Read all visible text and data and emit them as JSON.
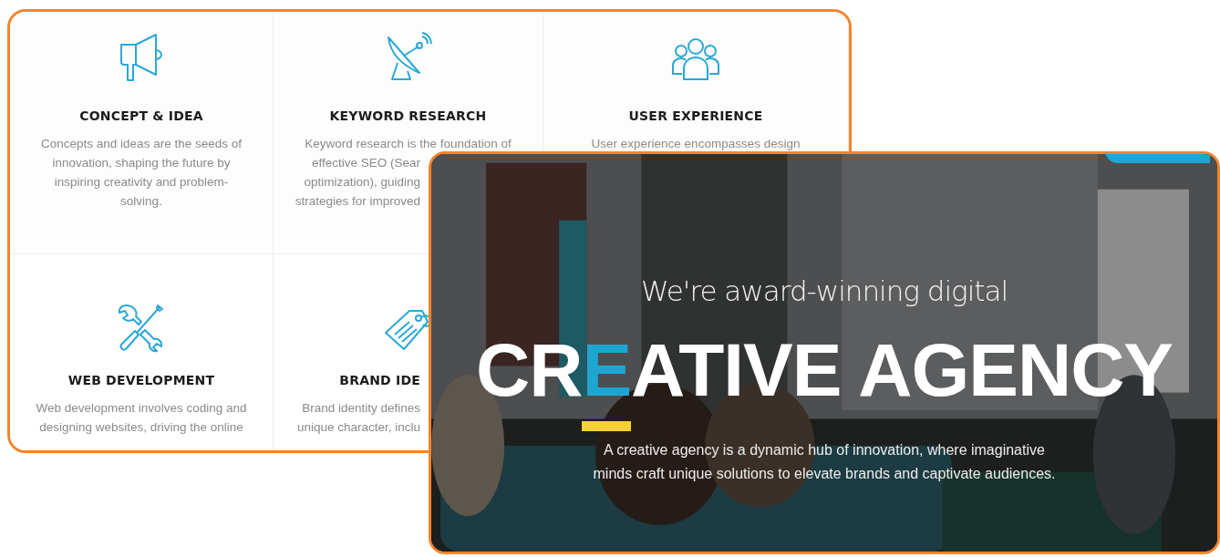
{
  "services_screenshot": {
    "services": [
      {
        "kind": "megaphone",
        "title": "CONCEPT & IDEA",
        "title_covered": false,
        "description_lines": [
          {
            "text": "Concepts and ideas are the seeds of",
            "covered": false
          },
          {
            "text": "innovation, shaping the future by",
            "covered": false
          },
          {
            "text": "inspiring creativity and problem-",
            "covered": false
          },
          {
            "text": "solving.",
            "covered": false
          }
        ]
      },
      {
        "kind": "satellite",
        "title": "KEYWORD RESEARCH",
        "title_covered": false,
        "description_lines": [
          {
            "text": "Keyword research is the foundation of",
            "covered": false
          },
          {
            "text": "effective SEO (Sear",
            "covered": true
          },
          {
            "text": "optimization), guiding",
            "covered": true
          },
          {
            "text": "strategies for improved",
            "covered": true
          }
        ]
      },
      {
        "kind": "users",
        "title": "USER EXPERIENCE",
        "title_covered": false,
        "description_lines": [
          {
            "text": "User experience encompasses design",
            "covered": false
          }
        ]
      },
      {
        "kind": "tools",
        "title": "WEB DEVELOPMENT",
        "title_covered": false,
        "description_lines": [
          {
            "text": "Web development involves coding and",
            "covered": false
          },
          {
            "text": "designing websites, driving the online",
            "covered": false
          }
        ]
      },
      {
        "kind": "tag",
        "title": "BRAND IDE",
        "title_covered": true,
        "description_lines": [
          {
            "text": "Brand identity defines",
            "covered": true
          },
          {
            "text": "unique character, inclu",
            "covered": true
          }
        ]
      }
    ]
  },
  "hero_screenshot": {
    "kicker": "We're award-winning digital",
    "headline": [
      {
        "text": "CR",
        "accent": false
      },
      {
        "text": "E",
        "accent": true
      },
      {
        "text": "ATIVE AGENCY",
        "accent": false
      }
    ],
    "description_lines": [
      "A creative agency is a dynamic hub of innovation, where imaginative",
      "minds craft unique solutions to elevate brands and captivate audiences."
    ]
  }
}
